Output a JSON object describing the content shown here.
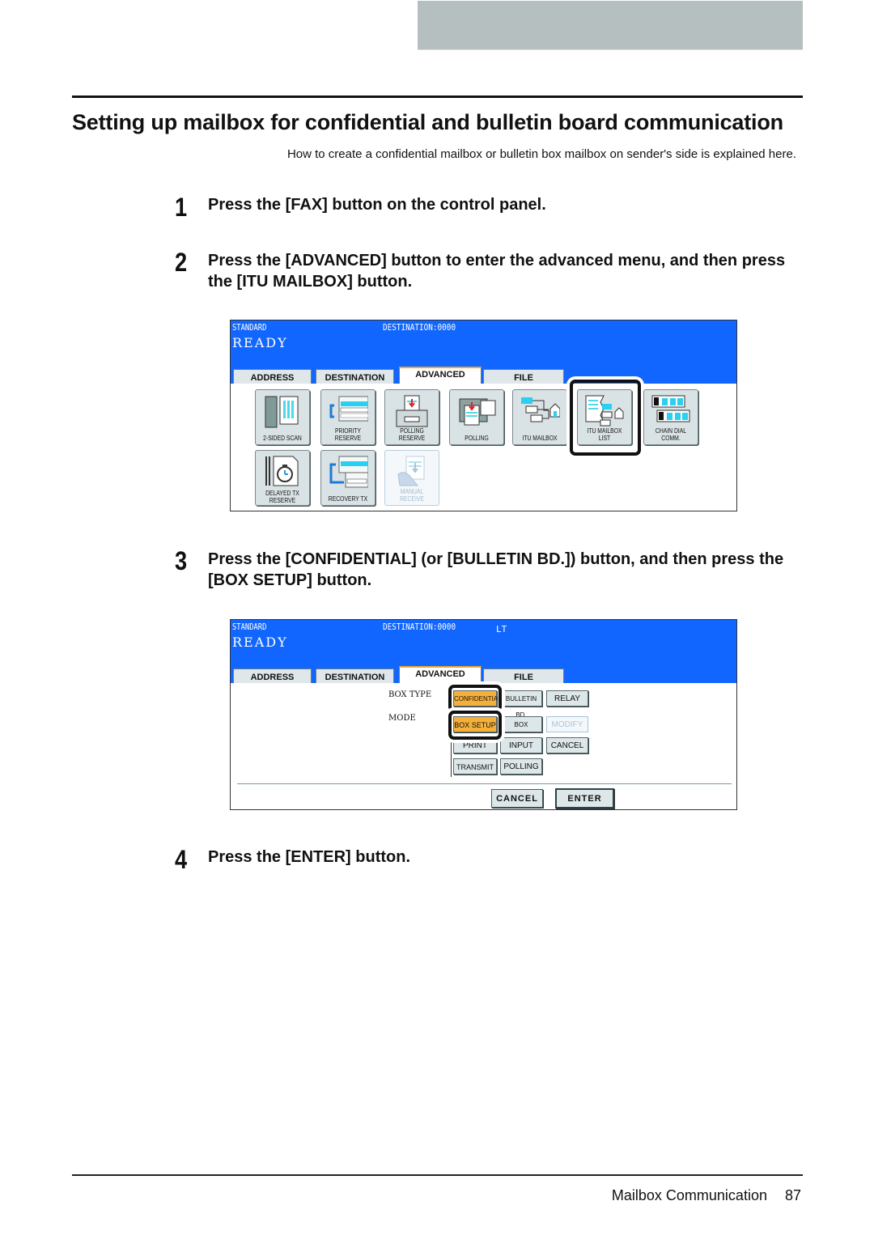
{
  "page": {
    "title": "Setting up mailbox for confidential and bulletin board communication",
    "intro": "How to create a confidential mailbox or bulletin box mailbox on sender's side is explained here.",
    "footer_section": "Mailbox Communication",
    "page_number": "87"
  },
  "steps": [
    {
      "num": "1",
      "text": "Press the [FAX] button on the control panel."
    },
    {
      "num": "2",
      "text": "Press the [ADVANCED] button to enter the advanced menu, and then press the [ITU MAILBOX] button."
    },
    {
      "num": "3",
      "text": "Press the [CONFIDENTIAL] (or [BULLETIN BD.]) button, and then press the [BOX SETUP] button."
    },
    {
      "num": "4",
      "text": "Press the [ENTER] button."
    }
  ],
  "screen1": {
    "mode": "STANDARD",
    "destination": "DESTINATION:0000",
    "status": "READY",
    "tabs": [
      "ADDRESS",
      "DESTINATION",
      "ADVANCED",
      "FILE"
    ],
    "active_tab": "ADVANCED",
    "buttons": [
      {
        "label": "2-SIDED SCAN",
        "icon": "two-sided-scan-icon"
      },
      {
        "label": "PRIORITY RESERVE",
        "icon": "priority-reserve-icon"
      },
      {
        "label": "POLLING RESERVE",
        "icon": "polling-reserve-icon"
      },
      {
        "label": "POLLING",
        "icon": "polling-icon"
      },
      {
        "label": "ITU MAILBOX",
        "icon": "itu-mailbox-icon"
      },
      {
        "label": "ITU MAILBOX LIST",
        "icon": "itu-mailbox-list-icon"
      },
      {
        "label": "CHAIN DIAL COMM.",
        "icon": "chain-dial-icon"
      },
      {
        "label": "DELAYED TX RESERVE",
        "icon": "delayed-tx-icon"
      },
      {
        "label": "RECOVERY TX",
        "icon": "recovery-tx-icon"
      },
      {
        "label": "MANUAL RECEIVE",
        "icon": "manual-receive-icon",
        "disabled": true
      }
    ]
  },
  "screen2": {
    "mode": "STANDARD",
    "destination": "DESTINATION:0000",
    "paper": "LT",
    "status": "READY",
    "tabs": [
      "ADDRESS",
      "DESTINATION",
      "ADVANCED",
      "FILE"
    ],
    "box_type_label": "BOX TYPE",
    "mode_label": "MODE",
    "box_type_options": [
      "CONFIDENTIAL",
      "BULLETIN BD.",
      "RELAY"
    ],
    "selected_box_type": "CONFIDENTIAL",
    "mode_options": [
      "BOX SETUP",
      "BOX DELETE",
      "MODIFY",
      "PRINT",
      "INPUT",
      "CANCEL",
      "TRANSMIT",
      "POLLING"
    ],
    "selected_mode": "BOX SETUP",
    "cancel_label": "CANCEL",
    "enter_label": "ENTER"
  },
  "colors": {
    "screen_blue": "#1166ff",
    "selected_orange": "#f5b03a",
    "header_gray": "#b6bfbf"
  }
}
